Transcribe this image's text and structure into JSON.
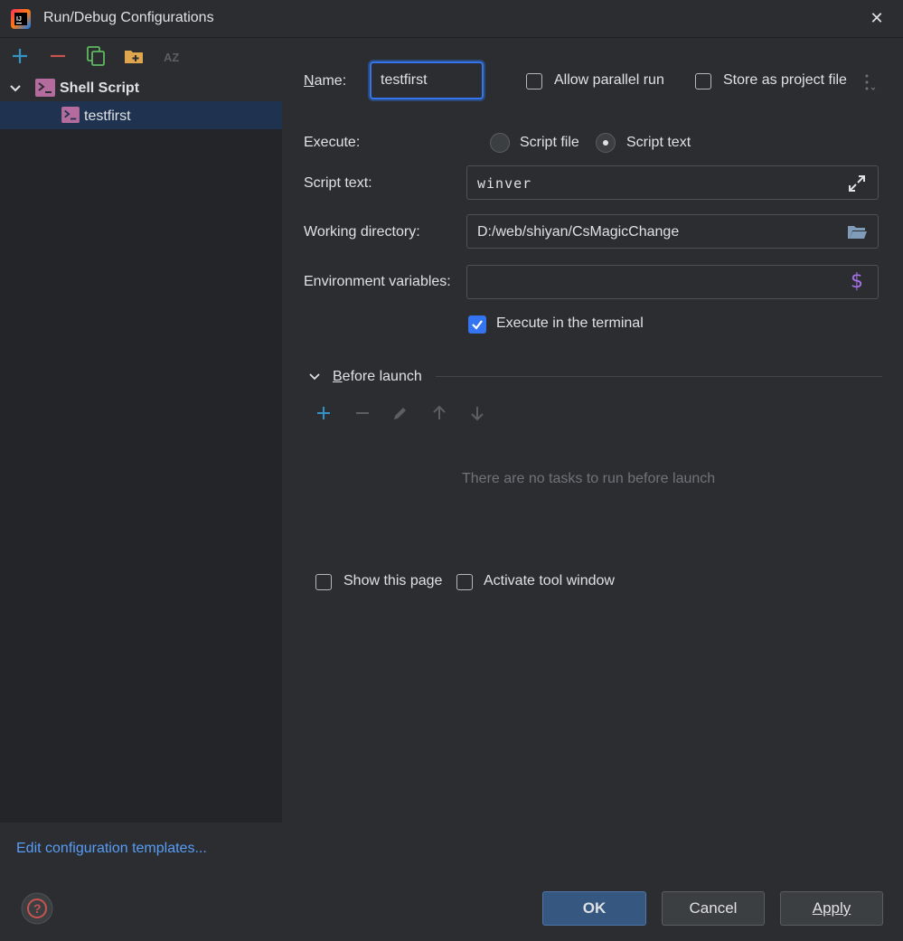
{
  "window": {
    "title": "Run/Debug Configurations"
  },
  "tree": {
    "root": "Shell Script",
    "child": "testfirst"
  },
  "form": {
    "name_label": "Name:",
    "name_value": "testfirst",
    "allow_parallel": "Allow parallel run",
    "store_project": "Store as project file",
    "execute_label": "Execute:",
    "execute_options": [
      "Script file",
      "Script text"
    ],
    "execute_selected": "Script text",
    "script_text_label": "Script text:",
    "script_text_value": "winver",
    "working_dir_label": "Working directory:",
    "working_dir_value": "D:/web/shiyan/CsMagicChange",
    "env_label": "Environment variables:",
    "env_value": "",
    "execute_terminal": "Execute in the terminal",
    "execute_terminal_checked": true,
    "before_launch": "Before launch",
    "no_tasks": "There are no tasks to run before launch",
    "show_page": "Show this page",
    "activate_tool": "Activate tool window"
  },
  "footer": {
    "edit_templates": "Edit configuration templates...",
    "ok": "OK",
    "cancel": "Cancel",
    "apply": "Apply"
  },
  "colors": {
    "accent_link": "#589df6",
    "add_icon": "#3592c4",
    "remove_icon": "#c75450",
    "folder_icon": "#e0a64d",
    "shell_icon": "#b46b9e"
  }
}
